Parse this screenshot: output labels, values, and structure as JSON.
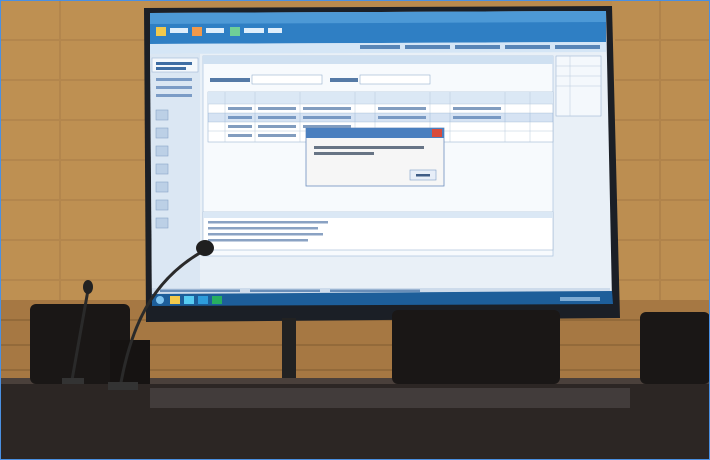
{
  "scene": {
    "description_icons": [
      "microphone-icon",
      "chair-icon",
      "display-screen-icon"
    ],
    "colors": {
      "wall": "#b98a4e",
      "wall_dark": "#8c6534",
      "screen_frame": "#1b1f26",
      "screen_content": "#e9f0f7",
      "taskbar": "#1d5e9a",
      "header_bar": "#2f7fc4",
      "table": "#2c2624",
      "chair": "#1a1716",
      "dialog_bg": "#f6f6f6",
      "dialog_title": "#4a7fbf"
    }
  }
}
